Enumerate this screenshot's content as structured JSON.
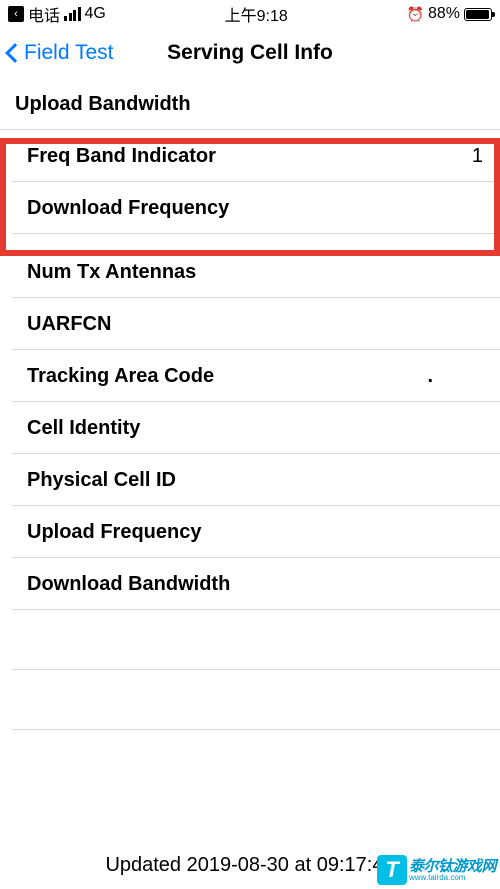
{
  "status": {
    "carrier": "电话",
    "network": "4G",
    "time": "上午9:18",
    "battery_pct": "88%"
  },
  "nav": {
    "back": "Field Test",
    "title": "Serving Cell Info"
  },
  "rows": [
    {
      "label": "Upload Bandwidth",
      "value": ""
    },
    {
      "label": "Freq Band Indicator",
      "value": "1"
    },
    {
      "label": "Download Frequency",
      "value": ""
    },
    {
      "label": "Num Tx Antennas",
      "value": ""
    },
    {
      "label": "UARFCN",
      "value": ""
    },
    {
      "label": "Tracking Area Code",
      "value": "."
    },
    {
      "label": "Cell Identity",
      "value": ""
    },
    {
      "label": "Physical Cell ID",
      "value": ""
    },
    {
      "label": "Upload Frequency",
      "value": ""
    },
    {
      "label": "Download Bandwidth",
      "value": ""
    }
  ],
  "footer": "Updated 2019-08-30 at 09:17:47",
  "watermark": {
    "brand": "泰尔钛游戏网",
    "url": "www.tairda.com"
  }
}
